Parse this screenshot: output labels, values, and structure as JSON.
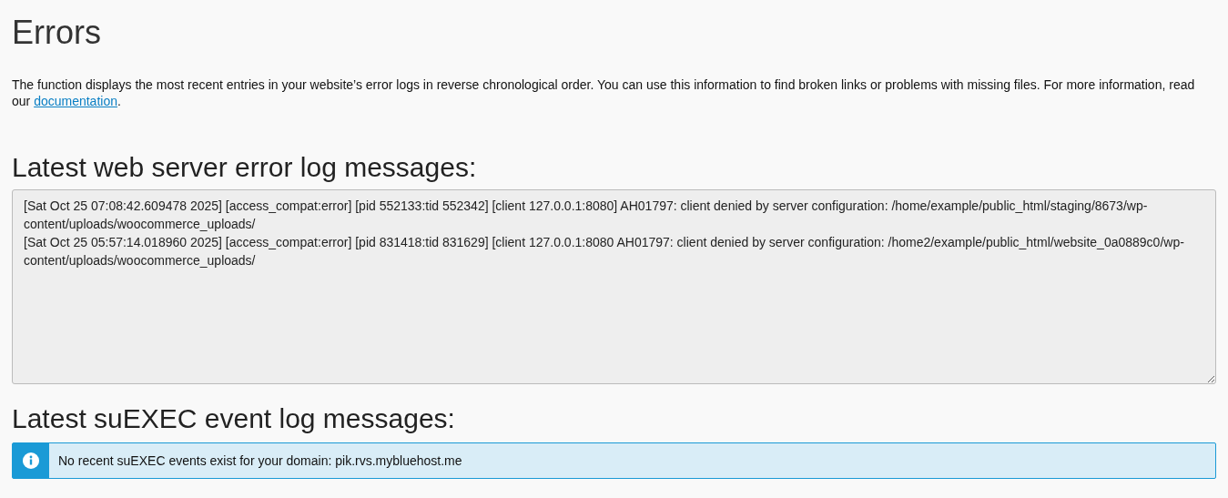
{
  "title": "Errors",
  "description": {
    "text": "The function displays the most recent entries in your website’s error logs in reverse chronological order. You can use this information to find broken links or problems with missing files. For more information, read our ",
    "link": "documentation",
    "end": "."
  },
  "web_server_log": {
    "heading": "Latest web server error log messages:",
    "entries": [
      "[Sat Oct 25 07:08:42.609478 2025] [access_compat:error] [pid 552133:tid 552342] [client 127.0.0.1:8080] AH01797: client denied by server configuration: /home/example/public_html/staging/8673/wp-content/uploads/woocommerce_uploads/",
      "[Sat Oct 25 05:57:14.018960 2025] [access_compat:error] [pid 831418:tid 831629] [client 127.0.0.1:8080 AH01797: client denied by server configuration: /home2/example/public_html/website_0a0889c0/wp-content/uploads/woocommerce_uploads/"
    ]
  },
  "suexec_log": {
    "heading": "Latest suEXEC event log messages:",
    "alert": {
      "kind": "info",
      "text": "No recent suEXEC events exist for your domain: pik.rvs.mybluehost.me"
    }
  }
}
